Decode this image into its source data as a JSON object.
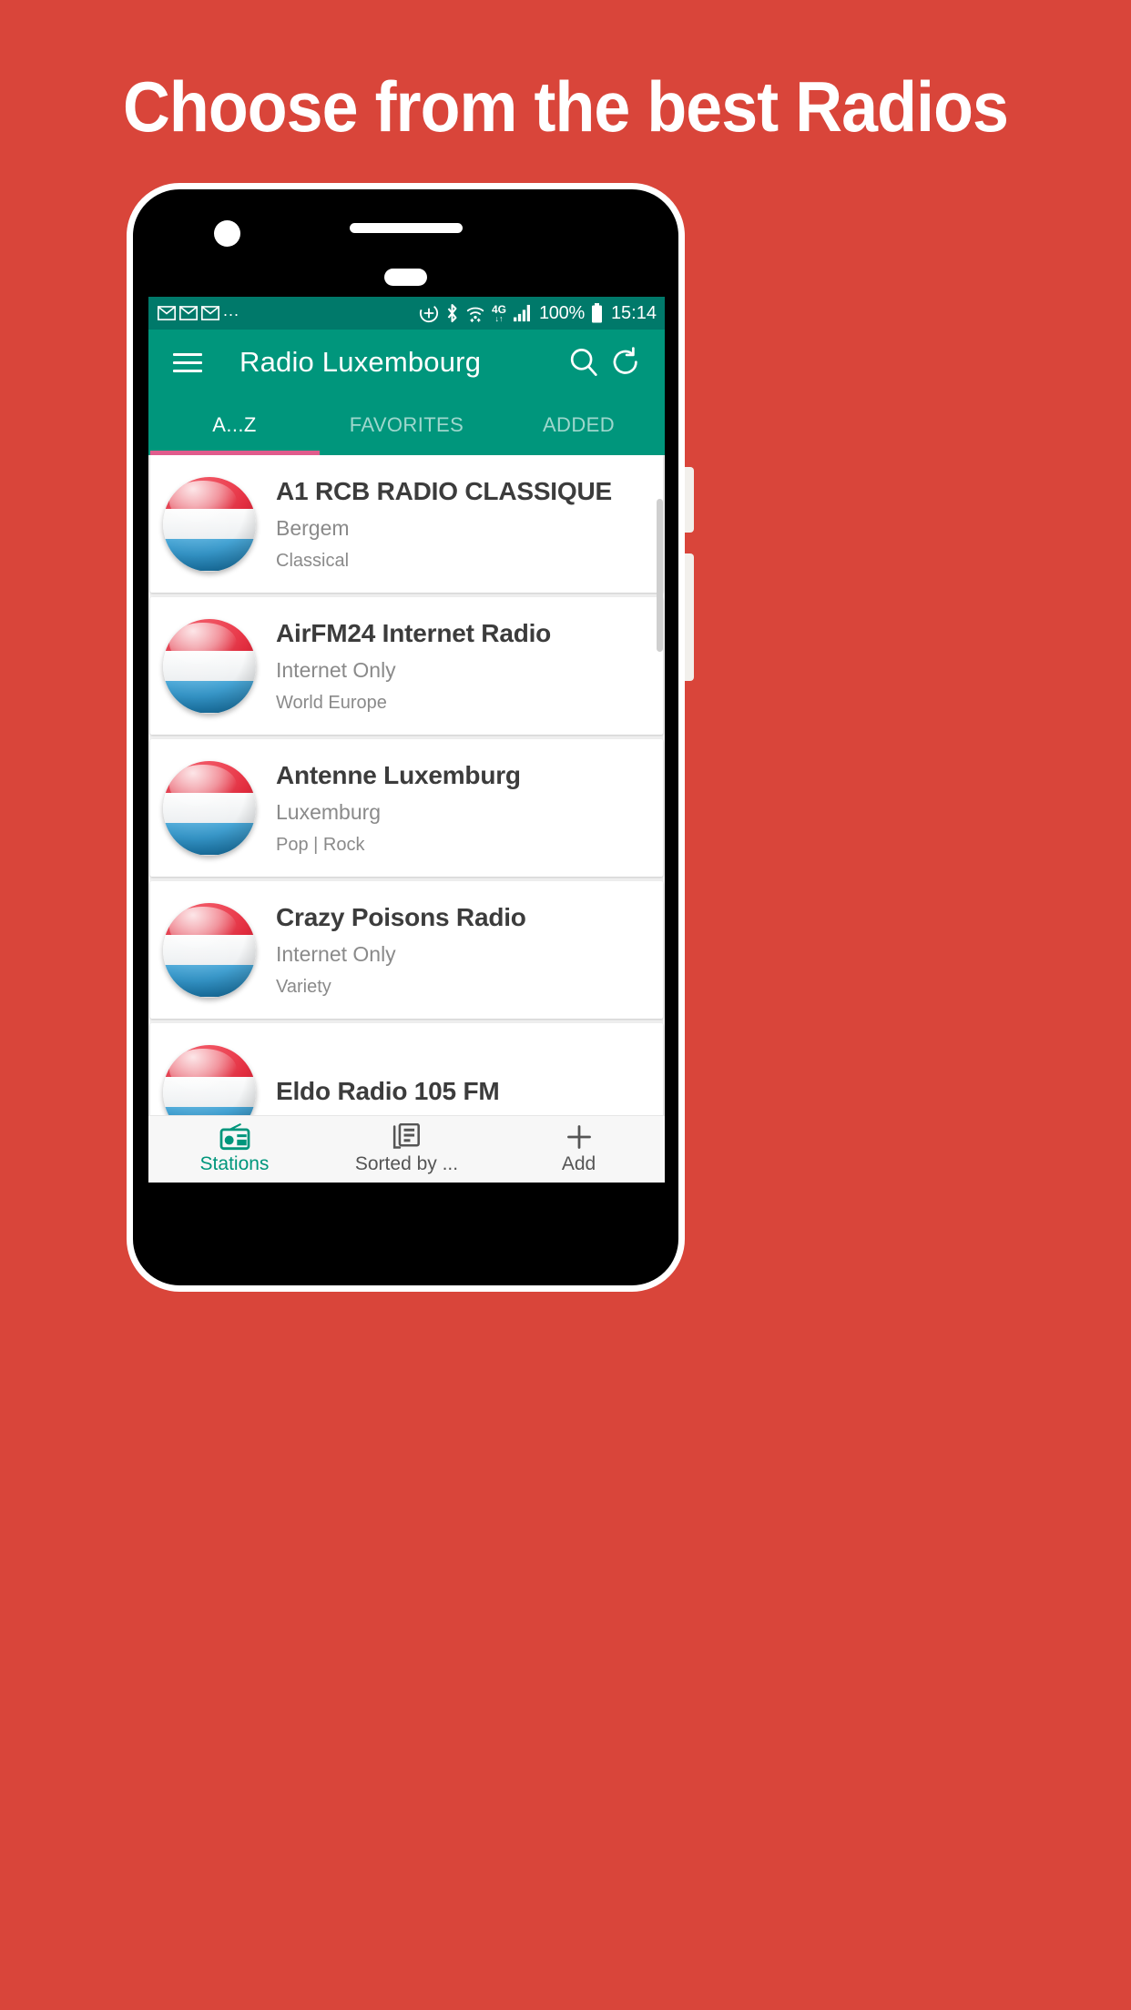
{
  "poster": {
    "headline": "Choose from the best Radios",
    "background_color": "#d9453a"
  },
  "statusbar": {
    "notification_icons": [
      "gmail-icon",
      "gmail-icon",
      "gmail-icon"
    ],
    "overflow": "...",
    "dnd_icon": "do-not-disturb-icon",
    "bluetooth_icon": "bluetooth-icon",
    "wifi_icon": "wifi-icon",
    "network": "4G",
    "signal_icon": "signal-bars-icon",
    "battery_percent": "100%",
    "battery_icon": "battery-full-icon",
    "time": "15:14"
  },
  "appbar": {
    "menu_icon": "hamburger-menu-icon",
    "title": "Radio Luxembourg",
    "search_icon": "search-icon",
    "refresh_icon": "refresh-icon",
    "background_color": "#00967c"
  },
  "tabs": {
    "items": [
      {
        "label": "A...Z",
        "active": true
      },
      {
        "label": "FAVORITES",
        "active": false
      },
      {
        "label": "ADDED",
        "active": false
      }
    ],
    "indicator_color": "#e05b8c"
  },
  "stations": [
    {
      "name": "A1 RCB RADIO CLASSIQUE",
      "location": "Bergem",
      "genre": "Classical",
      "flag": "luxembourg-flag-icon"
    },
    {
      "name": "AirFM24 Internet Radio",
      "location": "Internet Only",
      "genre": "World Europe",
      "flag": "luxembourg-flag-icon"
    },
    {
      "name": "Antenne Luxemburg",
      "location": "Luxemburg",
      "genre": "Pop | Rock",
      "flag": "luxembourg-flag-icon"
    },
    {
      "name": "Crazy Poisons Radio",
      "location": "Internet Only",
      "genre": "Variety",
      "flag": "luxembourg-flag-icon"
    },
    {
      "name": "Eldo Radio 105 FM",
      "location": "",
      "genre": "",
      "flag": "luxembourg-flag-icon"
    }
  ],
  "bottomnav": {
    "items": [
      {
        "label": "Stations",
        "icon": "radio-icon",
        "active": true
      },
      {
        "label": "Sorted by ...",
        "icon": "list-sort-icon",
        "active": false
      },
      {
        "label": "Add",
        "icon": "plus-icon",
        "active": false
      }
    ],
    "active_color": "#00967c"
  }
}
